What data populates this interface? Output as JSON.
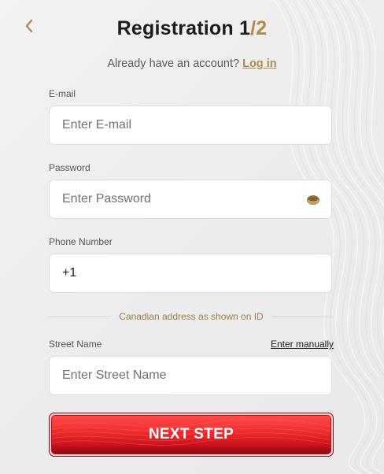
{
  "header": {
    "back_icon": "chevron-left-icon",
    "title_main": "Registration 1",
    "title_slash": "/",
    "title_total": "2"
  },
  "login_prompt": {
    "text": "Already have an account? ",
    "link_label": "Log in"
  },
  "fields": {
    "email": {
      "label": "E-mail",
      "placeholder": "Enter E-mail",
      "value": ""
    },
    "password": {
      "label": "Password",
      "placeholder": "Enter Password",
      "value": "",
      "toggle_icon": "eye-icon"
    },
    "phone": {
      "label": "Phone Number",
      "placeholder": "",
      "value": "+1"
    },
    "street": {
      "label": "Street Name",
      "placeholder": "Enter Street Name",
      "value": "",
      "manual_link": "Enter manually"
    }
  },
  "address_divider": "Canadian address as shown on ID",
  "submit": {
    "label": "NEXT STEP"
  },
  "colors": {
    "accent_gold": "#b08b4f",
    "button_red": "#e52a2a",
    "text_dark": "#1c1c1c",
    "background": "#eeeeee"
  }
}
